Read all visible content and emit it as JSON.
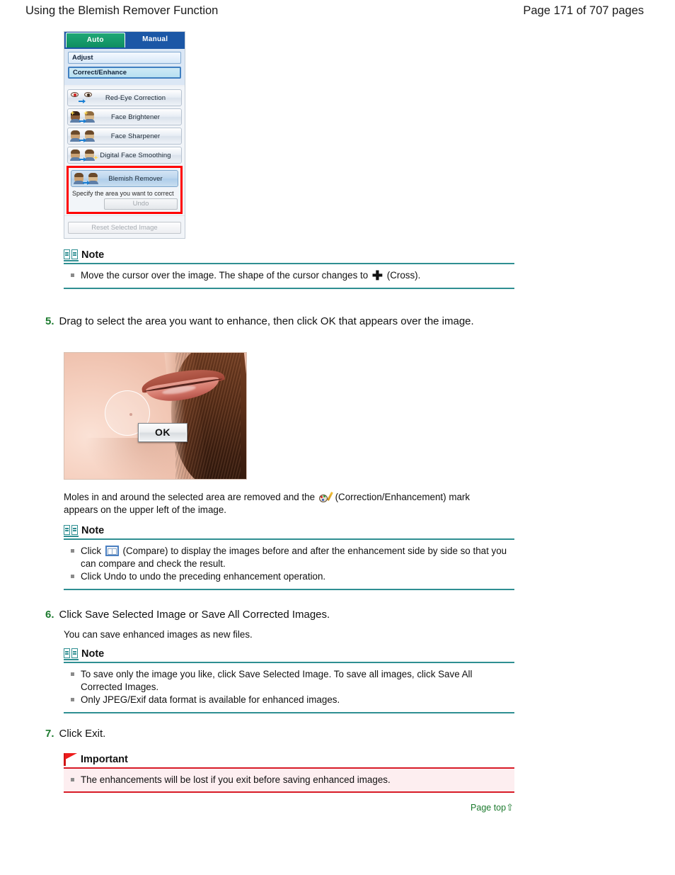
{
  "header": {
    "title": "Using the Blemish Remover Function",
    "page_label": "Page 171 of 707 pages"
  },
  "panel": {
    "tabs": [
      {
        "label": "Auto",
        "selected": false,
        "color": "#12946a"
      },
      {
        "label": "Manual",
        "selected": true,
        "color": "#1b57a6"
      }
    ],
    "sections": [
      {
        "label": "Adjust",
        "active": false
      },
      {
        "label": "Correct/Enhance",
        "active": true
      }
    ],
    "functions": [
      {
        "label": "Red-Eye Correction",
        "icon": "red-eye-icon",
        "selected": false
      },
      {
        "label": "Face Brightener",
        "icon": "face-brightener-icon",
        "selected": false
      },
      {
        "label": "Face Sharpener",
        "icon": "face-sharpener-icon",
        "selected": false
      },
      {
        "label": "Digital Face Smoothing",
        "icon": "digital-face-smoothing-icon",
        "selected": false
      },
      {
        "label": "Blemish Remover",
        "icon": "blemish-remover-icon",
        "selected": true
      }
    ],
    "hint": "Specify the area you want to correct",
    "undo_label": "Undo",
    "reset_label": "Reset Selected Image",
    "highlight_color": "#ff0000"
  },
  "note1": {
    "heading": "Note",
    "items": [
      {
        "before": "Move the cursor over the image. The shape of the cursor changes to",
        "icon": "cross-cursor-icon",
        "after": "(Cross)."
      }
    ]
  },
  "step5": {
    "number": "5.",
    "text": "Drag to select the area you want to enhance, then click OK that appears over the image.",
    "photo": {
      "ok_button_label": "OK",
      "selection_shape": "circle",
      "alt": "close-up of a face with a mole selected"
    },
    "result_before": "Moles in and around the selected area are removed and the",
    "result_icon": "correction-enhancement-icon",
    "result_after": "(Correction/Enhancement) mark appears on the upper left of the image."
  },
  "note2": {
    "heading": "Note",
    "items": [
      {
        "before": "Click",
        "icon": "compare-icon",
        "after": "(Compare) to display the images before and after the enhancement side by side so that you can compare and check the result."
      },
      {
        "text": "Click Undo to undo the preceding enhancement operation."
      }
    ]
  },
  "step6": {
    "number": "6.",
    "text": "Click Save Selected Image or Save All Corrected Images.",
    "sub_text": "You can save enhanced images as new files."
  },
  "note3": {
    "heading": "Note",
    "items": [
      {
        "text": "To save only the image you like, click Save Selected Image. To save all images, click Save All Corrected Images."
      },
      {
        "text": "Only JPEG/Exif data format is available for enhanced images."
      }
    ]
  },
  "step7": {
    "number": "7.",
    "text": "Click Exit."
  },
  "important": {
    "heading": "Important",
    "items": [
      {
        "text": "The enhancements will be lost if you exit before saving enhanced images."
      }
    ],
    "accent_color": "#d81c27",
    "background_color": "#fdeef0"
  },
  "footer": {
    "page_top_label": "Page top",
    "page_top_arrow": "⇧",
    "link_color": "#1c7a2e"
  }
}
